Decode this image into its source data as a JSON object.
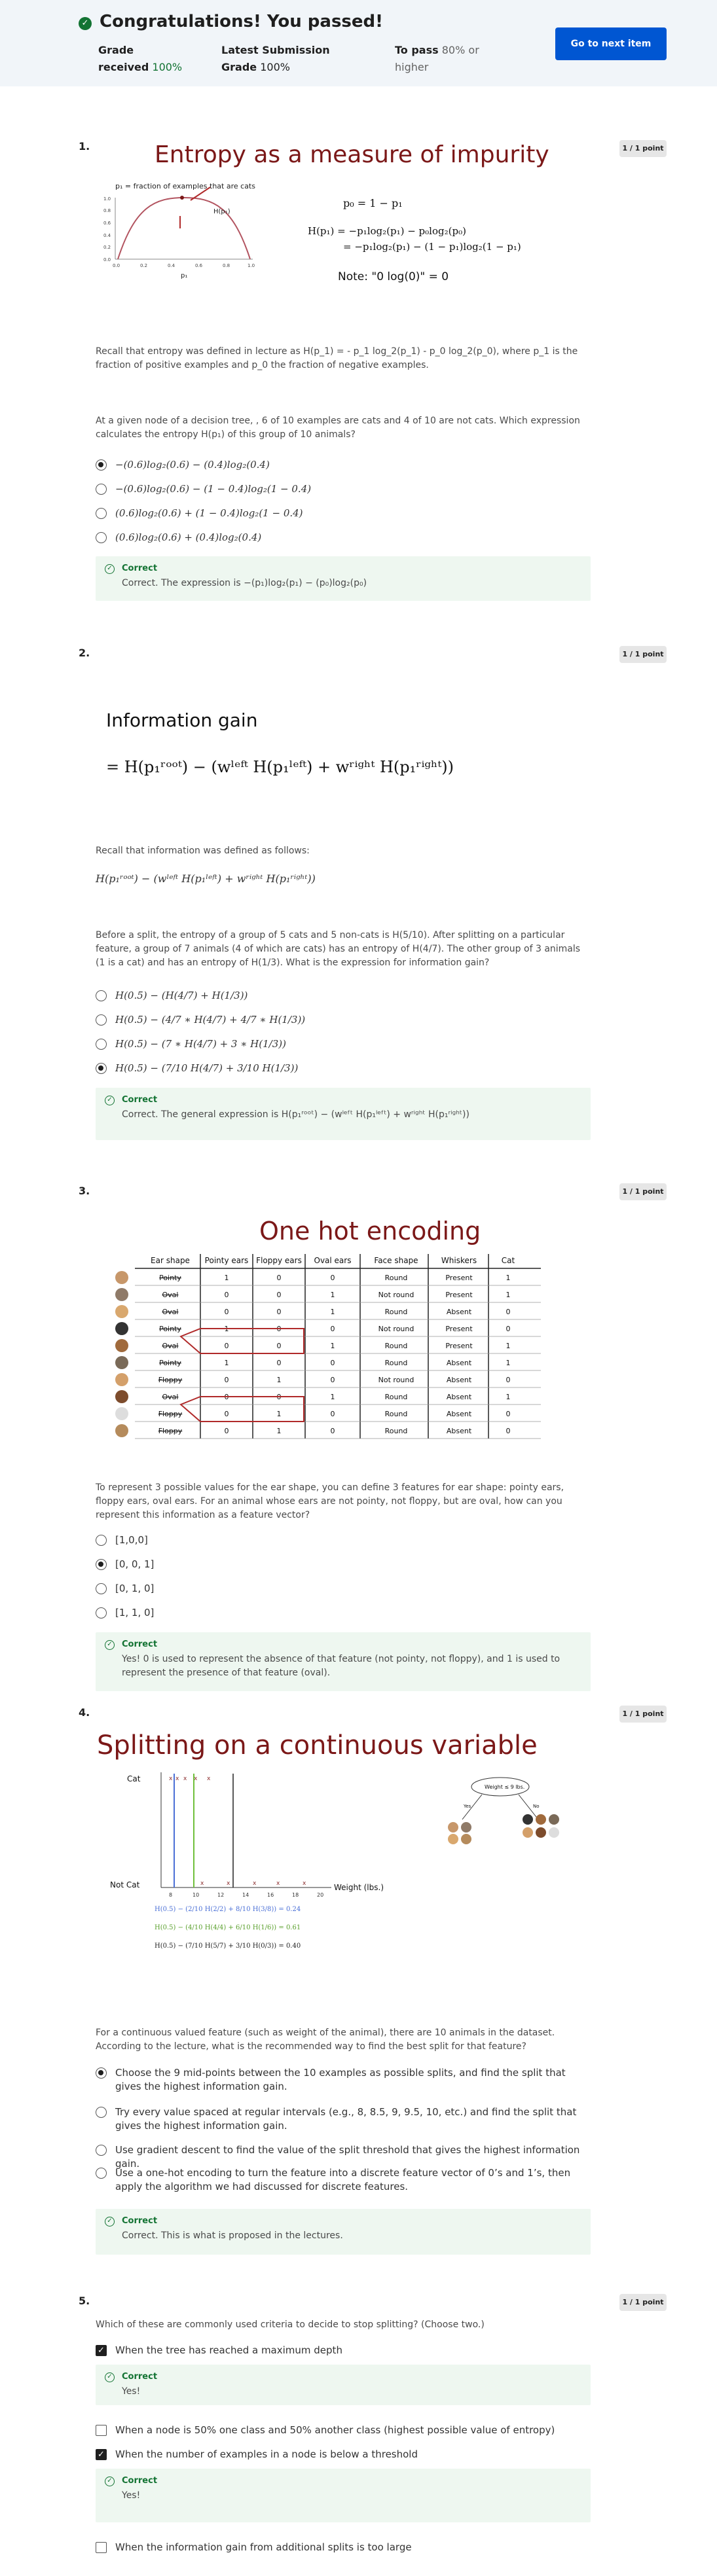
{
  "banner": {
    "title": "Congratulations! You passed!",
    "grade_received_label": "Grade received",
    "grade_received_value": "100%",
    "latest_label": "Latest Submission Grade",
    "latest_value": "100%",
    "to_pass_label": "To pass",
    "to_pass_value": "80% or higher",
    "next_button": "Go to next item",
    "colors": {
      "accent": "#0056d2",
      "success": "#137333",
      "banner_bg": "#f1f5f9"
    }
  },
  "questions": [
    {
      "number": "1.",
      "points": "1 / 1 point",
      "figure": {
        "title": "Entropy as a measure of impurity",
        "plot_label": "p₁ = fraction of examples that are cats",
        "curve_label": "H(p₁)",
        "x_label": "p₁",
        "y_ticks": [
          "1.0",
          "0.8",
          "0.6",
          "0.4",
          "0.2",
          "0.0"
        ],
        "x_ticks": [
          "0.0",
          "0.2",
          "0.4",
          "0.6",
          "0.8",
          "1.0"
        ],
        "eq1": "p₀ = 1 − p₁",
        "eq2": "H(p₁) = −p₁log₂(p₁) − p₀log₂(p₀)",
        "eq3": "= −p₁log₂(p₁) − (1 − p₁)log₂(1 − p₁)",
        "note": "Note: \"0 log(0)\" = 0"
      },
      "prompt1": "Recall that entropy was defined in lecture as H(p_1) = - p_1 log_2(p_1) - p_0 log_2(p_0), where p_1 is the fraction of positive examples and p_0 the fraction of negative examples.",
      "prompt2": "At a given node of a decision tree, , 6 of 10 examples are cats and 4 of 10 are not cats. Which expression calculates the entropy H(p₁) of this group of 10 animals?",
      "options": [
        "−(0.6)log₂(0.6) − (0.4)log₂(0.4)",
        "−(0.6)log₂(0.6) − (1 − 0.4)log₂(1 − 0.4)",
        "(0.6)log₂(0.6) + (1 − 0.4)log₂(1 − 0.4)",
        "(0.6)log₂(0.6) + (0.4)log₂(0.4)"
      ],
      "selected": 0,
      "feedback_title": "Correct",
      "feedback": "Correct. The expression is −(p₁)log₂(p₁) − (p₀)log₂(p₀)"
    },
    {
      "number": "2.",
      "points": "1 / 1 point",
      "figure": {
        "title": "Information gain",
        "formula": "= H(p₁ʳᵒᵒᵗ) − (wˡᵉᶠᵗ H(p₁ˡᵉᶠᵗ) + wʳⁱᵍʰᵗ H(p₁ʳⁱᵍʰᵗ))"
      },
      "prompt1": "Recall that information was defined as follows:",
      "formula_inline": "H(p₁ʳᵒᵒᵗ) − (wˡᵉᶠᵗ H(p₁ˡᵉᶠᵗ) + wʳⁱᵍʰᵗ H(p₁ʳⁱᵍʰᵗ))",
      "prompt2": "Before a split, the entropy of a group of 5 cats and 5 non-cats is H(5/10). After splitting on a particular feature, a group of 7 animals (4 of which are cats) has an entropy of H(4/7). The other group of 3 animals (1 is a cat) and has an entropy of H(1/3). What is the expression for information gain?",
      "options": [
        "H(0.5) − (H(4/7) + H(1/3))",
        "H(0.5) − (4/7 ∗ H(4/7) + 4/7 ∗ H(1/3))",
        "H(0.5) − (7 ∗ H(4/7) + 3 ∗ H(1/3))",
        "H(0.5) − (7/10 H(4/7) + 3/10 H(1/3))"
      ],
      "selected": 3,
      "feedback_title": "Correct",
      "feedback": "Correct. The general expression is H(p₁ʳᵒᵒᵗ) − (wˡᵉᶠᵗ H(p₁ˡᵉᶠᵗ) + wʳⁱᵍʰᵗ H(p₁ʳⁱᵍʰᵗ))"
    },
    {
      "number": "3.",
      "points": "1 / 1 point",
      "figure": {
        "title": "One hot encoding",
        "headers": [
          "Ear shape",
          "Pointy ears",
          "Floppy ears",
          "Oval ears",
          "Face shape",
          "Whiskers",
          "Cat"
        ],
        "rows": [
          [
            "Pointy",
            "1",
            "0",
            "0",
            "Round",
            "Present",
            "1"
          ],
          [
            "Oval",
            "0",
            "0",
            "1",
            "Not round",
            "Present",
            "1"
          ],
          [
            "Oval",
            "0",
            "0",
            "1",
            "Round",
            "Absent",
            "0"
          ],
          [
            "Pointy",
            "1",
            "0",
            "0",
            "Not round",
            "Present",
            "0"
          ],
          [
            "Oval",
            "0",
            "0",
            "1",
            "Round",
            "Present",
            "1"
          ],
          [
            "Pointy",
            "1",
            "0",
            "0",
            "Round",
            "Absent",
            "1"
          ],
          [
            "Floppy",
            "0",
            "1",
            "0",
            "Not round",
            "Absent",
            "0"
          ],
          [
            "Oval",
            "0",
            "0",
            "1",
            "Round",
            "Absent",
            "1"
          ],
          [
            "Floppy",
            "0",
            "1",
            "0",
            "Round",
            "Absent",
            "0"
          ],
          [
            "Floppy",
            "0",
            "1",
            "0",
            "Round",
            "Absent",
            "0"
          ]
        ]
      },
      "prompt1": "To represent 3 possible values for the ear shape, you can define 3 features for ear shape: pointy ears, floppy ears, oval ears. For an animal whose ears are not pointy, not floppy, but are oval, how can you represent this information as a feature vector?",
      "options": [
        "[1,0,0]",
        "[0, 0, 1]",
        "[0, 1, 0]",
        "[1, 1, 0]"
      ],
      "selected": 1,
      "feedback_title": "Correct",
      "feedback": "Yes! 0 is used to represent the absence of that feature (not pointy, not floppy), and 1 is used to represent the presence of that feature (oval)."
    },
    {
      "number": "4.",
      "points": "1 / 1 point",
      "figure": {
        "title": "Splitting on a continuous variable",
        "cat_label": "Cat",
        "notcat_label": "Not Cat",
        "axis_label": "Weight (lbs.)",
        "x_ticks": [
          "8",
          "10",
          "12",
          "14",
          "16",
          "18",
          "20"
        ],
        "tree_root": "Weight ≤ 9 lbs.",
        "yes": "Yes",
        "no": "No",
        "eq_blue": "H(0.5) − (2/10 H(2/2) + 8/10 H(3/8)) = 0.24",
        "eq_green": "H(0.5) − (4/10 H(4/4) + 6/10 H(1/6)) = 0.61",
        "eq_black": "H(0.5) − (7/10 H(5/7) + 3/10 H(0/3)) = 0.40"
      },
      "prompt1": "For a continuous valued feature (such as weight of the animal), there are 10 animals in the dataset. According to the lecture, what is the recommended way to find the best split for that feature?",
      "options": [
        "Choose the 9 mid-points between the 10 examples as possible splits, and find the split that gives the highest information gain.",
        "Try every value spaced at regular intervals (e.g., 8, 8.5, 9, 9.5, 10, etc.) and find the split that gives the highest information gain.",
        "Use gradient descent to find the value of the split threshold that gives the highest information gain.",
        "Use a one-hot encoding to turn the feature into a discrete feature vector of 0’s and 1’s, then apply the algorithm we had discussed for discrete features."
      ],
      "selected": 0,
      "feedback_title": "Correct",
      "feedback": "Correct. This is what is proposed in the lectures."
    },
    {
      "number": "5.",
      "points": "1 / 1 point",
      "prompt1": "Which of these are commonly used criteria to decide to stop splitting? (Choose two.)",
      "options": [
        "When the tree has reached a maximum depth",
        "When a node is 50% one class and 50% another class (highest possible value of entropy)",
        "When the number of examples in a node is below a threshold",
        "When the information gain from additional splits is too large"
      ],
      "checked": [
        true,
        false,
        true,
        false
      ],
      "feedback_title": "Correct",
      "feedback_a": "Yes!",
      "feedback_b": "Yes!"
    }
  ]
}
